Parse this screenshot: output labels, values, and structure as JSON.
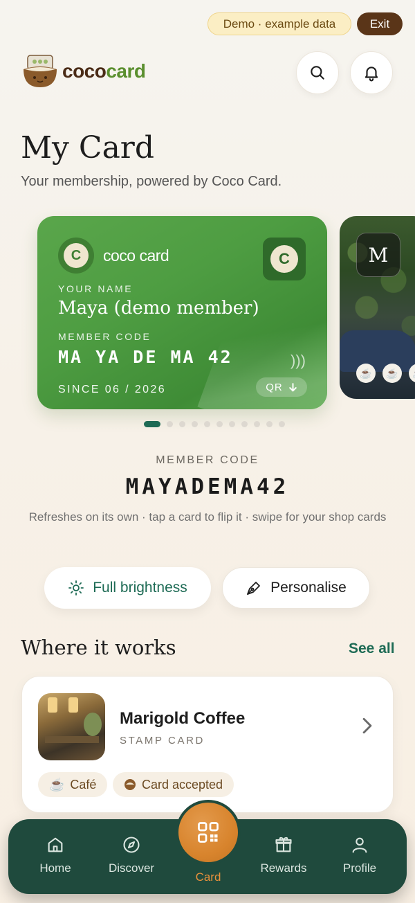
{
  "topbar": {
    "demo_label": "Demo · example data",
    "exit_label": "Exit"
  },
  "brand": {
    "name_part1": "coco",
    "name_part2": "card"
  },
  "header": {
    "title": "My Card",
    "subtitle": "Your membership, powered by Coco Card."
  },
  "card": {
    "brand": "coco card",
    "name_label": "YOUR NAME",
    "name": "Maya (demo member)",
    "code_label": "MEMBER CODE",
    "code": "MA YA DE MA 42",
    "since": "SINCE 06 / 2026",
    "qr_label": "QR"
  },
  "peek_card": {
    "initial": "M"
  },
  "carousel": {
    "total": 11,
    "active": 0
  },
  "member_code": {
    "label": "MEMBER CODE",
    "code": "MAYADEMA42",
    "hint": "Refreshes on its own · tap a card to flip it · swipe for your shop cards"
  },
  "actions": {
    "brightness_label": "Full brightness",
    "personalise_label": "Personalise"
  },
  "where_it_works": {
    "title": "Where it works",
    "see_all": "See all",
    "shop": {
      "name": "Marigold Coffee",
      "type": "STAMP CARD",
      "tags": [
        "Café",
        "Card accepted"
      ]
    }
  },
  "tabs": {
    "home": "Home",
    "discover": "Discover",
    "card": "Card",
    "rewards": "Rewards",
    "profile": "Profile"
  },
  "colors": {
    "accent": "#1e6b55",
    "card_green": "#4e9d42",
    "tabbar": "#1f4a3d",
    "center_tab": "#d8842d"
  }
}
